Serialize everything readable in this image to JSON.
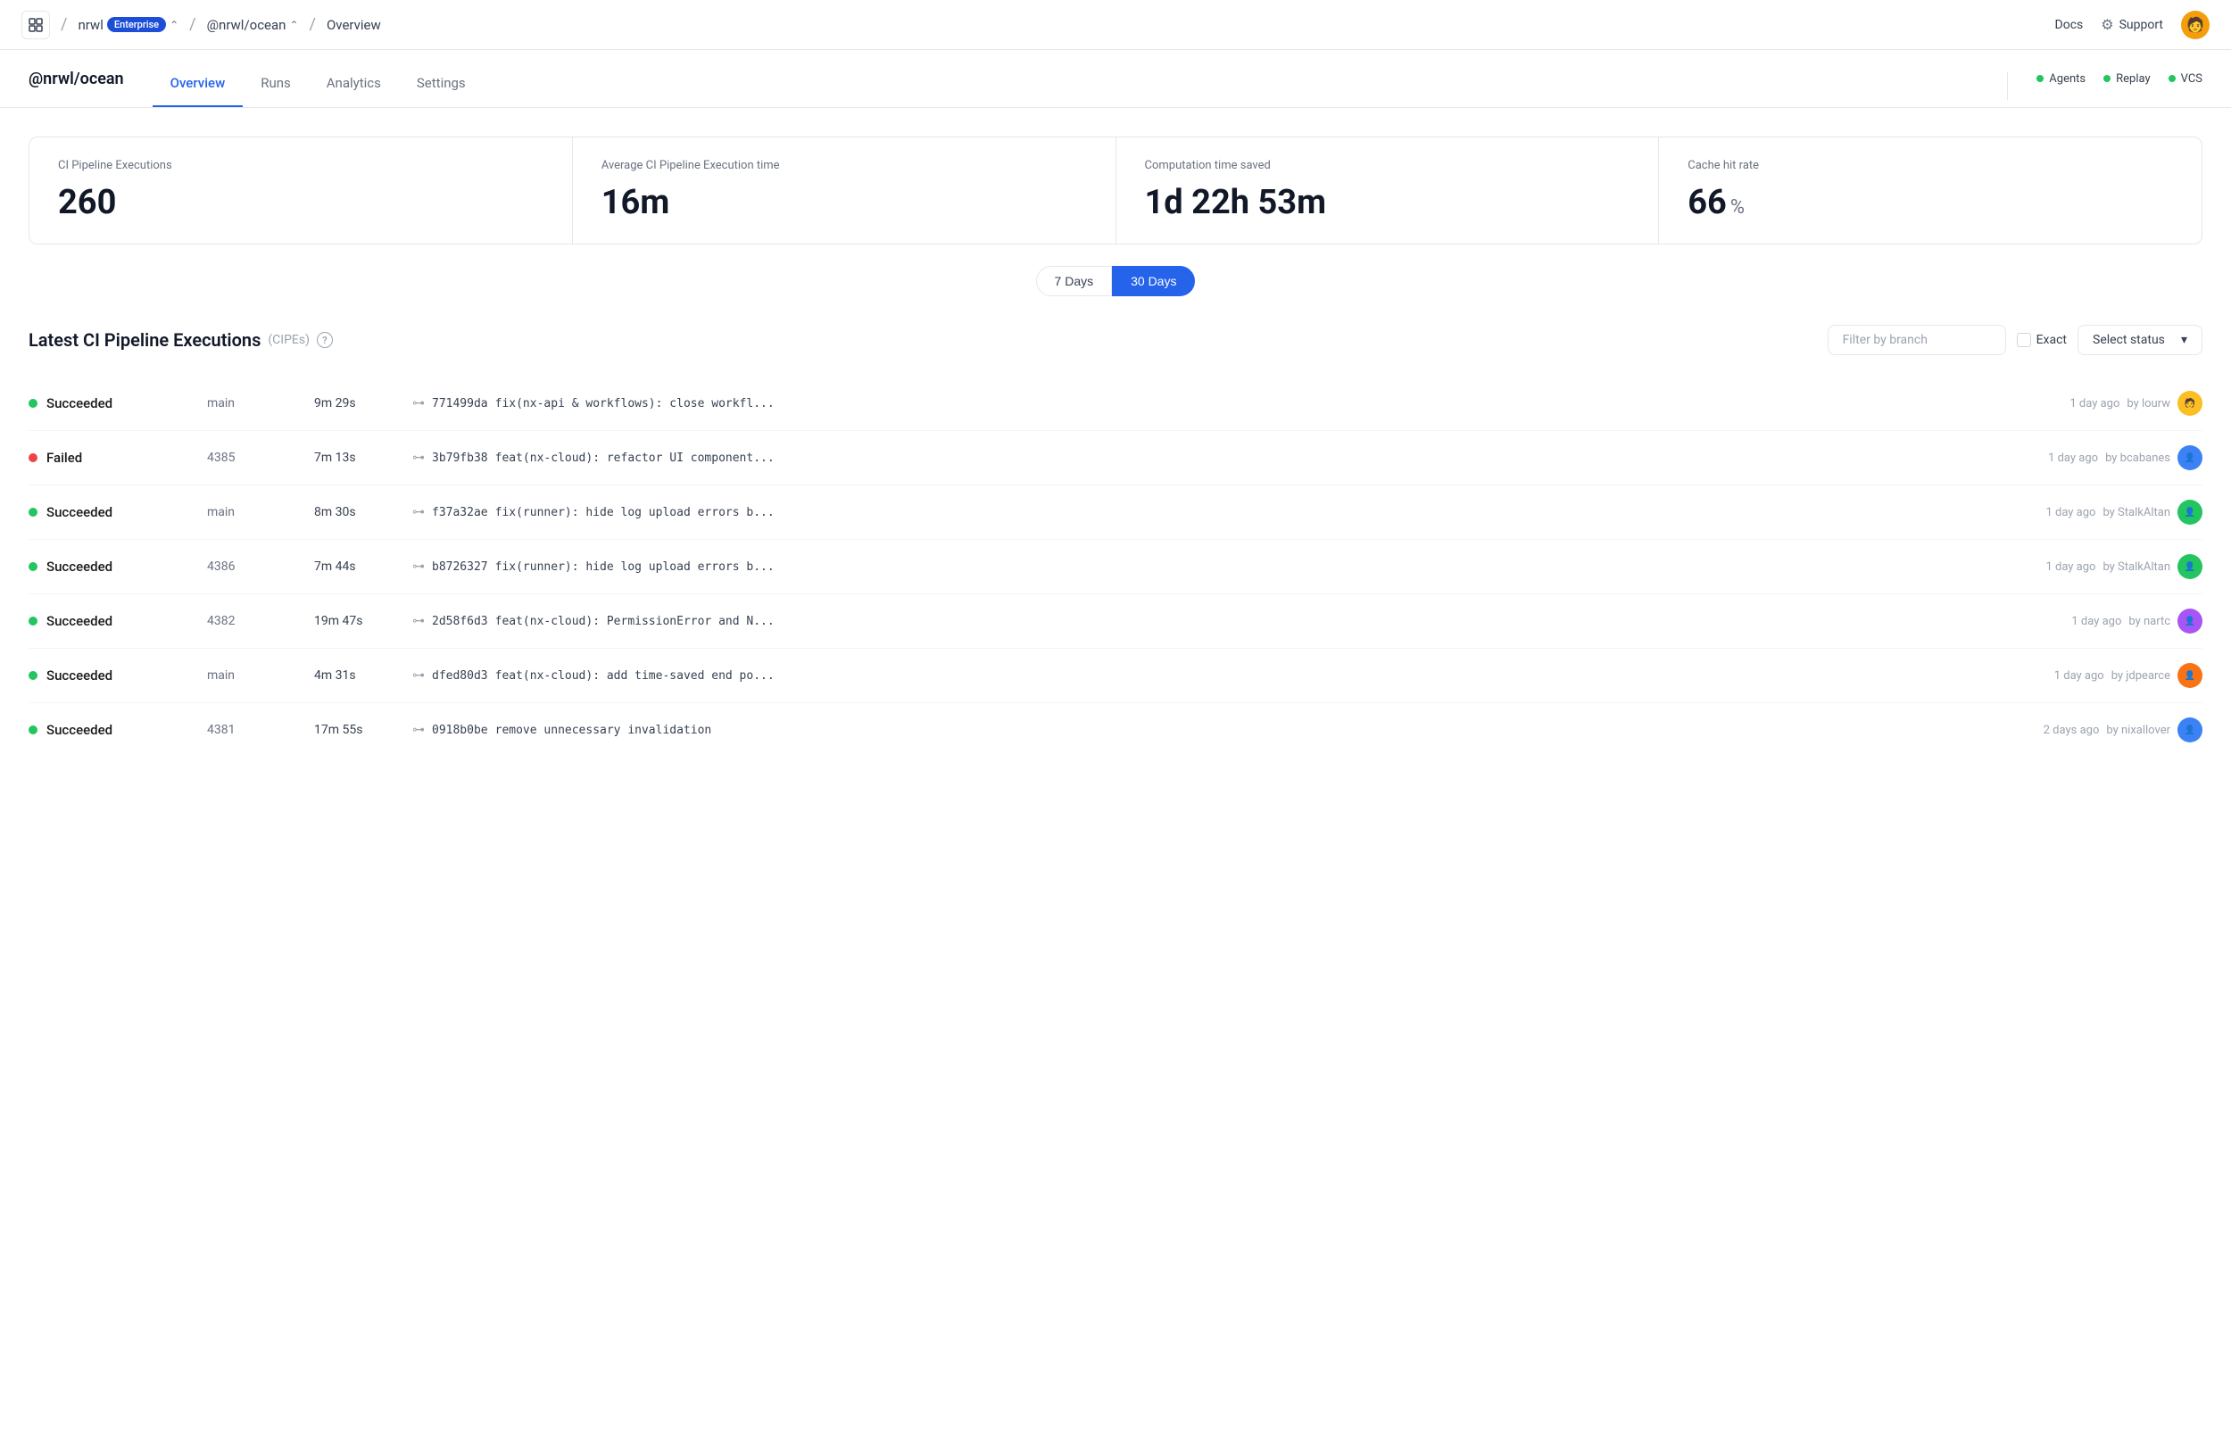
{
  "topnav": {
    "logo_icon": "☐",
    "org": "nrwl",
    "enterprise_badge": "Enterprise",
    "workspace": "@nrwl/ocean",
    "page": "Overview",
    "docs_label": "Docs",
    "support_label": "Support"
  },
  "header": {
    "org_title": "@nrwl/ocean",
    "tabs": [
      {
        "label": "Overview",
        "active": true
      },
      {
        "label": "Runs",
        "active": false
      },
      {
        "label": "Analytics",
        "active": false
      },
      {
        "label": "Settings",
        "active": false
      }
    ],
    "status_indicators": [
      {
        "label": "Agents"
      },
      {
        "label": "Replay"
      },
      {
        "label": "VCS"
      }
    ]
  },
  "stats": {
    "period_buttons": [
      "7 Days",
      "30 Days"
    ],
    "active_period": "30 Days",
    "cards": [
      {
        "label": "CI Pipeline Executions",
        "value": "260",
        "unit": ""
      },
      {
        "label": "Average CI Pipeline Execution time",
        "value": "16m",
        "unit": ""
      },
      {
        "label": "Computation time saved",
        "value": "1d 22h 53m",
        "unit": ""
      },
      {
        "label": "Cache hit rate",
        "value": "66",
        "unit": "%"
      }
    ]
  },
  "pipeline": {
    "title": "Latest CI Pipeline Executions",
    "subtitle": "(CIPEs)",
    "filter_branch_placeholder": "Filter by branch",
    "exact_label": "Exact",
    "status_select_label": "Select status",
    "rows": [
      {
        "status": "Succeeded",
        "status_type": "success",
        "branch": "main",
        "duration": "9m 29s",
        "commit_hash": "771499da",
        "commit_msg": "fix(nx-api & workflows): close workfl...",
        "time_ago": "1 day ago",
        "author": "by lourw",
        "avatar_color": "av-yellow"
      },
      {
        "status": "Failed",
        "status_type": "failed",
        "branch": "4385",
        "duration": "7m 13s",
        "commit_hash": "3b79fb38",
        "commit_msg": "feat(nx-cloud): refactor UI component...",
        "time_ago": "1 day ago",
        "author": "by bcabanes",
        "avatar_color": "av-blue"
      },
      {
        "status": "Succeeded",
        "status_type": "success",
        "branch": "main",
        "duration": "8m 30s",
        "commit_hash": "f37a32ae",
        "commit_msg": "fix(runner): hide log upload errors b...",
        "time_ago": "1 day ago",
        "author": "by StalkAltan",
        "avatar_color": "av-green"
      },
      {
        "status": "Succeeded",
        "status_type": "success",
        "branch": "4386",
        "duration": "7m 44s",
        "commit_hash": "b8726327",
        "commit_msg": "fix(runner): hide log upload errors b...",
        "time_ago": "1 day ago",
        "author": "by StalkAltan",
        "avatar_color": "av-green"
      },
      {
        "status": "Succeeded",
        "status_type": "success",
        "branch": "4382",
        "duration": "19m 47s",
        "commit_hash": "2d58f6d3",
        "commit_msg": "feat(nx-cloud): PermissionError and N...",
        "time_ago": "1 day ago",
        "author": "by nartc",
        "avatar_color": "av-purple"
      },
      {
        "status": "Succeeded",
        "status_type": "success",
        "branch": "main",
        "duration": "4m 31s",
        "commit_hash": "dfed80d3",
        "commit_msg": "feat(nx-cloud): add time-saved end po...",
        "time_ago": "1 day ago",
        "author": "by jdpearce",
        "avatar_color": "av-orange"
      },
      {
        "status": "Succeeded",
        "status_type": "success",
        "branch": "4381",
        "duration": "17m 55s",
        "commit_hash": "0918b0be",
        "commit_msg": "remove unnecessary invalidation",
        "time_ago": "2 days ago",
        "author": "by nixallover",
        "avatar_color": "av-blue"
      }
    ]
  }
}
